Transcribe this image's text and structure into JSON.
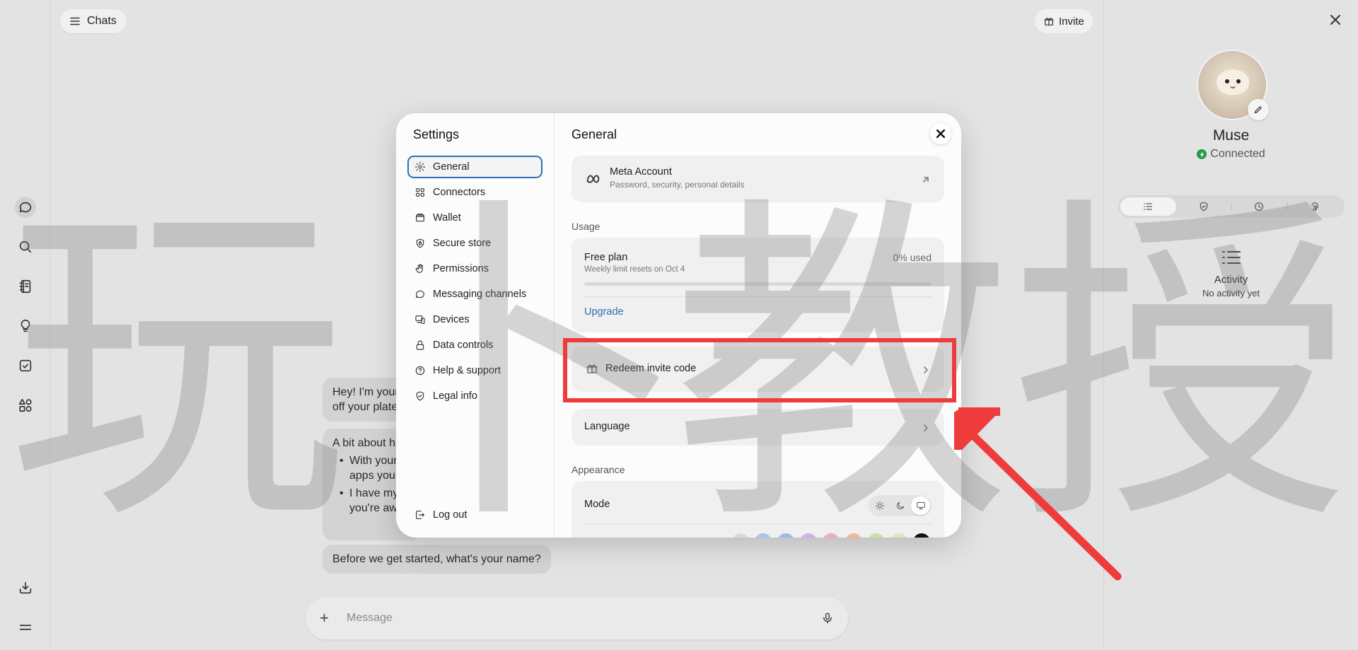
{
  "topbar": {
    "chats_label": "Chats",
    "invite_label": "Invite"
  },
  "rail": {
    "icons": [
      "chat-icon",
      "search-icon",
      "notebook-icon",
      "lightbulb-icon",
      "checkbox-icon",
      "apps-icon",
      "download-icon",
      "menu-icon"
    ]
  },
  "chat": {
    "bubble1_line1": "Hey! I'm your",
    "bubble1_line2": "off your plate",
    "bubble2_title": "A bit about h",
    "bubble2_items": [
      {
        "line1": "With your",
        "line2": "apps you"
      },
      {
        "line1": "I have my",
        "line2": "you're aw"
      }
    ],
    "bubble3": "Before we get started, what's your name?",
    "composer_placeholder": "Message"
  },
  "agent": {
    "name": "Muse",
    "status": "Connected",
    "activity_title": "Activity",
    "activity_sub": "No activity yet"
  },
  "settings": {
    "title": "Settings",
    "nav": [
      {
        "label": "General",
        "icon": "gear-icon"
      },
      {
        "label": "Connectors",
        "icon": "grid-icon"
      },
      {
        "label": "Wallet",
        "icon": "wallet-icon"
      },
      {
        "label": "Secure store",
        "icon": "shield-lock-icon"
      },
      {
        "label": "Permissions",
        "icon": "hand-icon"
      },
      {
        "label": "Messaging channels",
        "icon": "message-icon"
      },
      {
        "label": "Devices",
        "icon": "devices-icon"
      },
      {
        "label": "Data controls",
        "icon": "lock-icon"
      },
      {
        "label": "Help & support",
        "icon": "help-icon"
      },
      {
        "label": "Legal info",
        "icon": "shield-check-icon"
      }
    ],
    "logout": "Log out",
    "section_title": "General",
    "account": {
      "title": "Meta Account",
      "sub": "Password, security, personal details"
    },
    "usage_label": "Usage",
    "plan": {
      "name": "Free plan",
      "reset": "Weekly limit resets on Oct 4",
      "used": "0% used",
      "used_fraction": 0,
      "upgrade": "Upgrade"
    },
    "redeem": "Redeem invite code",
    "language": "Language",
    "appearance_label": "Appearance",
    "mode_label": "Mode",
    "mode_selected": "system",
    "swatch_colors": [
      "#d9d9d9",
      "#a9c4ea",
      "#9fb8e8",
      "#c9b3ea",
      "#f0a9c6",
      "#f2b79a",
      "#c9e3a4",
      "#e8e0c8",
      "#111111"
    ]
  },
  "watermark": {
    "chars": "玩 卜 教 授"
  },
  "annotation": {
    "color": "#ef3b3b"
  }
}
